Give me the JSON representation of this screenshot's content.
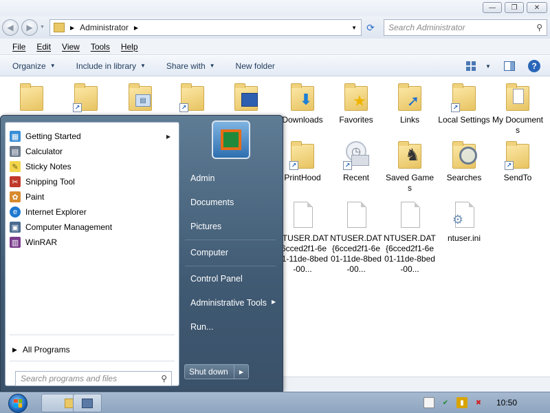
{
  "window": {
    "buttons": {
      "minimize": "—",
      "maximize": "❐",
      "close": "✕"
    },
    "address": {
      "path_label": "Administrator"
    },
    "search": {
      "placeholder": "Search Administrator"
    },
    "menu": [
      "File",
      "Edit",
      "View",
      "Tools",
      "Help"
    ],
    "toolbar": {
      "organize": "Organize",
      "include": "Include in library",
      "share": "Share with",
      "newfolder": "New folder"
    }
  },
  "files": {
    "row1": [
      {
        "label": "",
        "type": "folder"
      },
      {
        "label": "",
        "type": "folder-shortcut"
      },
      {
        "label": "",
        "type": "folder-contacts"
      },
      {
        "label": "",
        "type": "folder-shortcut"
      },
      {
        "label": "",
        "type": "folder-desktop"
      },
      {
        "label": "Downloads",
        "type": "folder-downloads"
      },
      {
        "label": "Favorites",
        "type": "folder-favorites"
      },
      {
        "label": "Links",
        "type": "folder-links"
      },
      {
        "label": "Local Settings",
        "type": "folder-shortcut"
      },
      {
        "label": "My Documents",
        "type": "folder-docs"
      }
    ],
    "row2": [
      {
        "label": "PrintHood",
        "type": "folder-shortcut"
      },
      {
        "label": "Recent",
        "type": "recent-shortcut"
      },
      {
        "label": "Saved Games",
        "type": "folder-games"
      },
      {
        "label": "Searches",
        "type": "folder-searches"
      },
      {
        "label": "SendTo",
        "type": "folder-shortcut"
      }
    ],
    "row3": [
      {
        "label": "NTUSER.DAT{6cced2f1-6e01-11de-8bed-00...",
        "type": "file"
      },
      {
        "label": "NTUSER.DAT{6cced2f1-6e01-11de-8bed-00...",
        "type": "file"
      },
      {
        "label": "NTUSER.DAT{6cced2f1-6e01-11de-8bed-00...",
        "type": "file"
      },
      {
        "label": "ntuser.ini",
        "type": "settings-file"
      }
    ]
  },
  "startmenu": {
    "programs": [
      {
        "label": "Getting Started",
        "icon": "getting-started-icon",
        "color": "#3a8ed6",
        "submenu": true
      },
      {
        "label": "Calculator",
        "icon": "calculator-icon",
        "color": "#6b7a8c"
      },
      {
        "label": "Sticky Notes",
        "icon": "sticky-notes-icon",
        "color": "#f2d54c"
      },
      {
        "label": "Snipping Tool",
        "icon": "snipping-tool-icon",
        "color": "#c0392b"
      },
      {
        "label": "Paint",
        "icon": "paint-icon",
        "color": "#d88b2e"
      },
      {
        "label": "Internet Explorer",
        "icon": "internet-explorer-icon",
        "color": "#1f79d0"
      },
      {
        "label": "Computer Management",
        "icon": "computer-management-icon",
        "color": "#4a6b8f"
      },
      {
        "label": "WinRAR",
        "icon": "winrar-icon",
        "color": "#7a3c8c"
      }
    ],
    "all_programs": "All Programs",
    "search_placeholder": "Search programs and files",
    "right": {
      "admin": "Admin",
      "documents": "Documents",
      "pictures": "Pictures",
      "computer": "Computer",
      "control_panel": "Control Panel",
      "admin_tools": "Administrative Tools",
      "run": "Run..."
    },
    "shutdown": "Shut down"
  },
  "taskbar": {
    "clock": "10:50"
  }
}
